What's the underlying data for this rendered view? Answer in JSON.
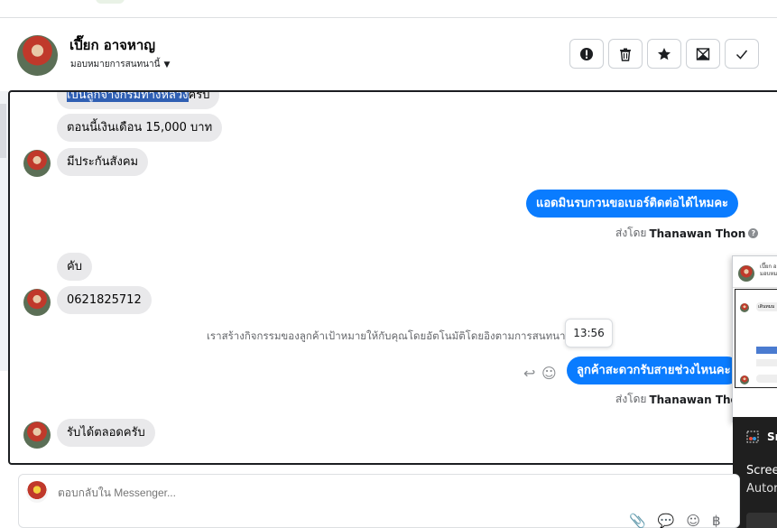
{
  "header": {
    "contact_name": "เปี๊ยก อาจหาญ",
    "assign_label": "มอบหมายการสนทนานี้",
    "actions": [
      {
        "name": "report-button",
        "icon": "exclamation-icon"
      },
      {
        "name": "delete-button",
        "icon": "trash-icon"
      },
      {
        "name": "star-button",
        "icon": "star-icon"
      },
      {
        "name": "mark-unread-button",
        "icon": "envelope-icon"
      },
      {
        "name": "mark-done-button",
        "icon": "check-icon"
      }
    ]
  },
  "messages": {
    "m1_pre": "เป็นลูกจ้างกรมทางหลวง",
    "m1_post": "ครับ",
    "m2": "ตอนนี้เงินเดือน 15,000 บาท",
    "m3": "มีประกันสังคม",
    "m4": "แอดมินรบกวนขอเบอร์ติดต่อได้ไหมคะ",
    "m5": "คับ",
    "m6": "0621825712",
    "m7": "ลูกค้าสะดวกรับสายช่วงไหนคะ",
    "m8": "รับได้ตลอดครับ"
  },
  "sent_by": {
    "prefix": "ส่งโดย",
    "agent": "Thanawan Thon"
  },
  "system_note": "เราสร้างกิจกรรมของลูกค้าเป้าหมายให้กับคุณโดยอัตโนมัติโดยอิงตามการสนทนานี้",
  "tooltip_time": "13:56",
  "float_window": {
    "name": "เปี๊ยก อ",
    "sub": "มอบหมา",
    "bubble": "เดินทมม"
  },
  "toast": {
    "app": "Sn",
    "line1": "Scree",
    "line2": "Autor"
  },
  "composer": {
    "placeholder": "ตอบกลับใน Messenger..."
  },
  "colors": {
    "outgoing_bubble": "#0a7cff",
    "incoming_bubble": "#e9e9eb",
    "highlight": "#2f5fb3"
  }
}
